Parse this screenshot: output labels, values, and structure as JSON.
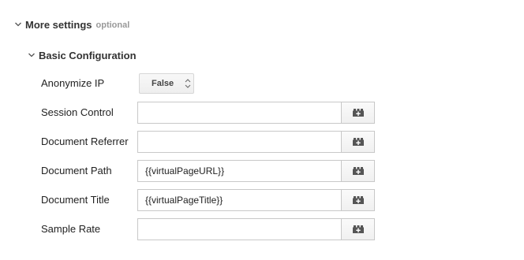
{
  "more_settings": {
    "title": "More settings",
    "optional_label": "optional",
    "icon": "chevron-down-icon"
  },
  "basic_configuration": {
    "title": "Basic Configuration",
    "icon": "chevron-down-icon"
  },
  "anonymize_ip": {
    "label": "Anonymize IP",
    "selected": "False",
    "icon": "updown-arrows-icon"
  },
  "fields": {
    "session_control": {
      "label": "Session Control",
      "value": ""
    },
    "document_referrer": {
      "label": "Document Referrer",
      "value": ""
    },
    "document_path": {
      "label": "Document Path",
      "value": "{{virtualPageURL}}"
    },
    "document_title": {
      "label": "Document Title",
      "value": "{{virtualPageTitle}}"
    },
    "sample_rate": {
      "label": "Sample Rate",
      "value": ""
    }
  },
  "variable_button_icon": "add-variable-brick-icon",
  "colors": {
    "text": "#222222",
    "muted": "#999999",
    "border": "#c8c8c8",
    "icon": "#555555"
  }
}
